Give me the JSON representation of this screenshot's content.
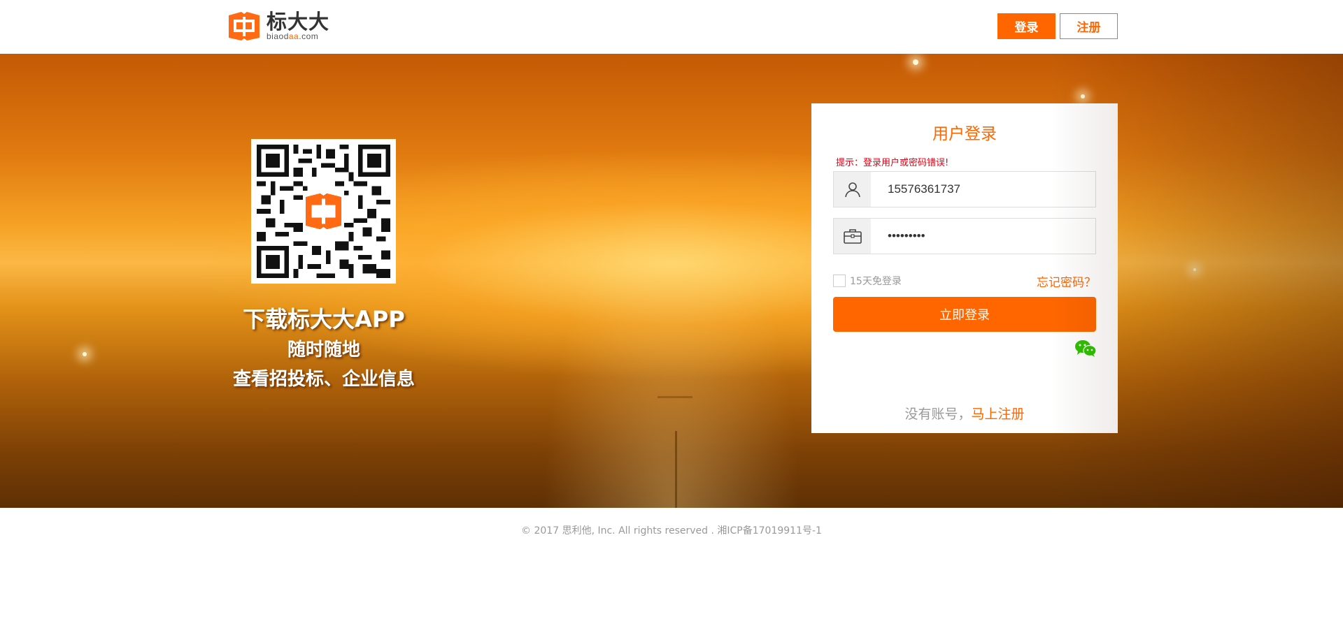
{
  "header": {
    "logo_cn": "标大大",
    "logo_en_prefix": "biaod",
    "logo_en_accent": "aa",
    "logo_en_suffix": ".com",
    "login_label": "登录",
    "register_label": "注册"
  },
  "promo": {
    "line1": "下载标大大APP",
    "line2": "随时随地",
    "line3": "查看招投标、企业信息"
  },
  "login": {
    "title": "用户登录",
    "hint": "提示：登录用户或密码错误!",
    "username_value": "15576361737",
    "password_value": "•••••••••",
    "remember_label": "15天免登录",
    "forgot_label": "忘记密码？",
    "submit_label": "立即登录",
    "no_account_text": "没有账号，",
    "register_now_label": "马上注册"
  },
  "footer": {
    "copyright": "© 2017 思利他, Inc. All rights reserved . 湘ICP备17019911号-1"
  },
  "icons": {
    "user": "user-icon",
    "password": "briefcase-icon",
    "wechat": "wechat-icon",
    "qr": "qr-code"
  },
  "colors": {
    "accent": "#ff6600",
    "error": "#e60012"
  }
}
